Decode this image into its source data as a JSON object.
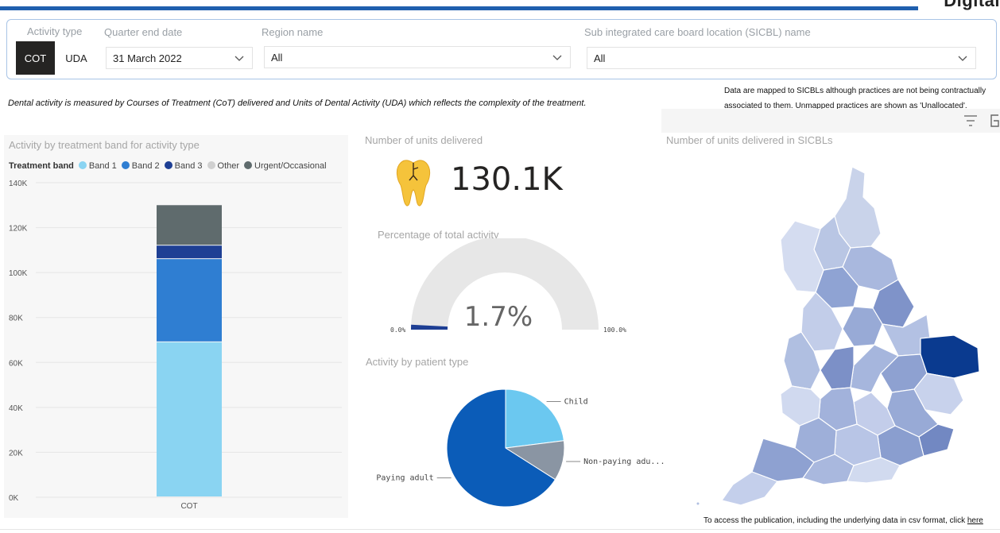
{
  "brand": "Digital",
  "filters": {
    "activity_type": {
      "label": "Activity type",
      "options": [
        "COT",
        "UDA"
      ],
      "selected": "COT"
    },
    "quarter": {
      "label": "Quarter end date",
      "value": "31 March 2022"
    },
    "region": {
      "label": "Region name",
      "value": "All"
    },
    "sicbl": {
      "label": "Sub integrated care board location (SICBL) name",
      "value": "All"
    }
  },
  "notes": {
    "description": "Dental activity is measured by Courses of Treatment (CoT) delivered and Units of Dental Activity (UDA) which reflects the complexity of the treatment.",
    "mapping_line1": "Data are mapped to SICBLs although practices are not being contractually",
    "mapping_line2": "associated to them. Unmapped practices are shown as 'Unallocated'.",
    "footer": "To access the publication, including the underlying data in csv format, click",
    "footer_link": "here"
  },
  "panels": {
    "band_chart_title": "Activity by treatment band for activity type",
    "units_title": "Number of units delivered",
    "units_value": "130.1K",
    "gauge_title": "Percentage of total activity",
    "patient_title": "Activity by patient type",
    "map_title": "Number of units delivered in SICBLs"
  },
  "legend": {
    "title": "Treatment band",
    "items": [
      {
        "name": "Band 1",
        "color": "#8ad4f2"
      },
      {
        "name": "Band 2",
        "color": "#2f7ed2"
      },
      {
        "name": "Band 3",
        "color": "#1e3f94"
      },
      {
        "name": "Other",
        "color": "#d0d0d0"
      },
      {
        "name": "Urgent/Occasional",
        "color": "#5f6b6d"
      }
    ]
  },
  "chart_data": [
    {
      "type": "bar",
      "stacked": true,
      "title": "Activity by treatment band for activity type",
      "categories": [
        "COT"
      ],
      "series": [
        {
          "name": "Band 1",
          "values": [
            69000
          ],
          "color": "#8ad4f2"
        },
        {
          "name": "Band 2",
          "values": [
            37000
          ],
          "color": "#2f7ed2"
        },
        {
          "name": "Band 3",
          "values": [
            6000
          ],
          "color": "#1e3f94"
        },
        {
          "name": "Other",
          "values": [
            0
          ],
          "color": "#d0d0d0"
        },
        {
          "name": "Urgent/Occasional",
          "values": [
            18000
          ],
          "color": "#5f6b6d"
        }
      ],
      "yticks": [
        "0K",
        "20K",
        "40K",
        "60K",
        "80K",
        "100K",
        "120K",
        "140K"
      ],
      "ylim": [
        0,
        140000
      ]
    },
    {
      "type": "gauge",
      "title": "Percentage of total activity",
      "value": 1.7,
      "display": "1.7%",
      "min_label": "0.0%",
      "max_label": "100.0%",
      "min": 0,
      "max": 100
    },
    {
      "type": "pie",
      "title": "Activity by patient type",
      "slices": [
        {
          "name": "Child",
          "value": 23,
          "color": "#6bc8f0"
        },
        {
          "name": "Non-paying adu...",
          "value": 11,
          "color": "#8a95a3"
        },
        {
          "name": "Paying adult",
          "value": 66,
          "color": "#0b5cb8"
        }
      ]
    }
  ]
}
